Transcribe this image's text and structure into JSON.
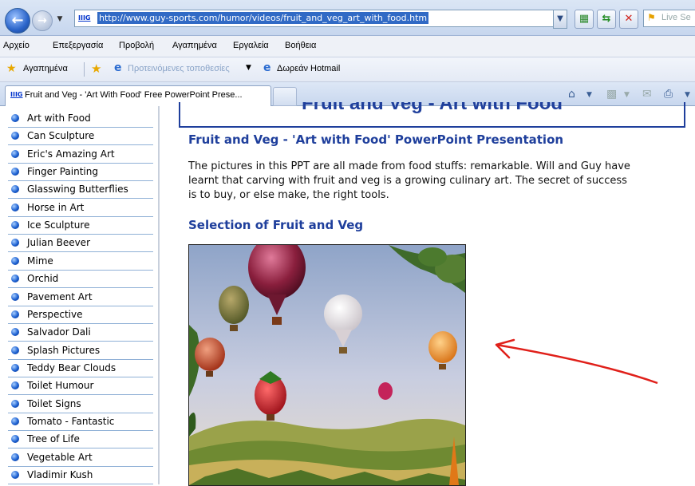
{
  "browser": {
    "url": "http://www.guy-sports.com/humor/videos/fruit_and_veg_art_with_food.htm",
    "favicon_text": "IIIG",
    "search_placeholder": "Live Se",
    "menu": [
      "Αρχείο",
      "Επεξεργασία",
      "Προβολή",
      "Αγαπημένα",
      "Εργαλεία",
      "Βοήθεια"
    ],
    "favorites_bar": {
      "favorites_label": "Αγαπημένα",
      "suggested_sites": "Προτεινόμενες τοποθεσίες",
      "hotmail": "Δωρεάν Hotmail"
    },
    "tab_title": "Fruit and Veg - 'Art With Food' Free PowerPoint Prese..."
  },
  "page": {
    "banner_title": "Fruit and Veg - Art with Food",
    "heading": "Fruit and Veg - 'Art with Food' PowerPoint Presentation",
    "intro_lines": [
      "The pictures in this PPT are all made from food stuffs: remarkable.  Will and Guy have",
      "learnt that carving with fruit and veg is a growing culinary art.  The secret of success",
      "is to buy, or else make, the right tools."
    ],
    "subheading": "Selection of Fruit and Veg"
  },
  "sidebar": {
    "items": [
      "Art with Food",
      "Can Sculpture",
      "Eric's Amazing Art",
      "Finger Painting",
      "Glasswing Butterflies",
      "Horse in Art",
      "Ice Sculpture",
      "Julian Beever",
      "Mime",
      "Orchid",
      "Pavement Art",
      "Perspective",
      "Salvador Dali",
      "Splash Pictures",
      "Teddy Bear Clouds",
      "Toilet Humour",
      "Toilet Signs",
      "Tomato - Fantastic",
      "Tree of Life",
      "Vegetable Art",
      "Vladimir Kush"
    ]
  },
  "colors": {
    "accent": "#1f3f9c",
    "annotation_arrow": "#e0201a",
    "selection": "#316ac5"
  }
}
